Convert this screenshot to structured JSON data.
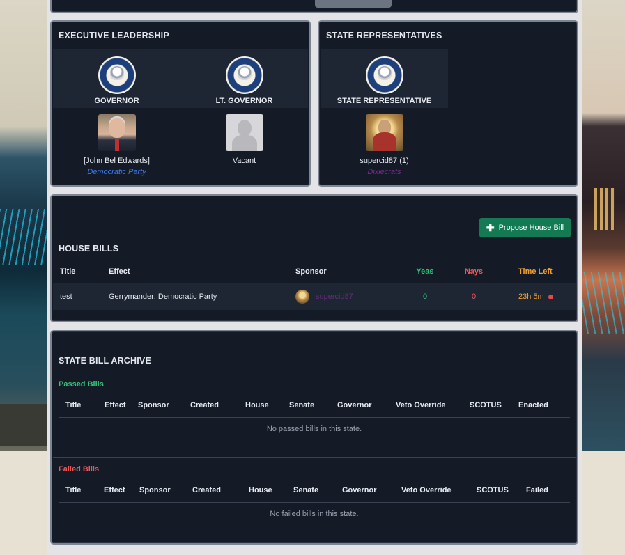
{
  "executive": {
    "title": "EXECUTIVE LEADERSHIP",
    "seats": [
      {
        "label": "GOVERNOR",
        "name": "[John Bel Edwards]",
        "party": "Democratic Party"
      },
      {
        "label": "LT. GOVERNOR",
        "name": "Vacant",
        "party": ""
      }
    ]
  },
  "representatives": {
    "title": "STATE REPRESENTATIVES",
    "seats": [
      {
        "label": "STATE REPRESENTATIVE",
        "name": "supercid87 (1)",
        "party": "Dixiecrats"
      }
    ]
  },
  "house_bills": {
    "title": "HOUSE BILLS",
    "propose_label": "Propose House Bill",
    "columns": [
      "Title",
      "Effect",
      "Sponsor",
      "Yeas",
      "Nays",
      "Time Left"
    ],
    "rows": [
      {
        "title": "test",
        "effect": "Gerrymander: Democratic Party",
        "sponsor": "supercid87",
        "yeas": "0",
        "nays": "0",
        "time_left": "23h 5m"
      }
    ]
  },
  "archive": {
    "title": "STATE BILL ARCHIVE",
    "passed": {
      "label": "Passed Bills",
      "columns": [
        "Title",
        "Effect",
        "Sponsor",
        "Created",
        "House",
        "Senate",
        "Governor",
        "Veto Override",
        "SCOTUS",
        "Enacted"
      ],
      "empty": "No passed bills in this state."
    },
    "failed": {
      "label": "Failed Bills",
      "columns": [
        "Title",
        "Effect",
        "Sponsor",
        "Created",
        "House",
        "Senate",
        "Governor",
        "Veto Override",
        "SCOTUS",
        "Failed"
      ],
      "empty": "No failed bills in this state."
    }
  },
  "colors": {
    "panel_bg": "#141a26",
    "accent_green": "#137a54",
    "yeas": "#34c47a",
    "nays": "#e85a5a",
    "time": "#f0a030",
    "democratic": "#3a7bf0",
    "dixiecrats": "#7a2a8c"
  },
  "icons": {
    "seal": "louisiana-seal-icon",
    "plus": "plus-icon",
    "status": "red-dot-icon"
  }
}
